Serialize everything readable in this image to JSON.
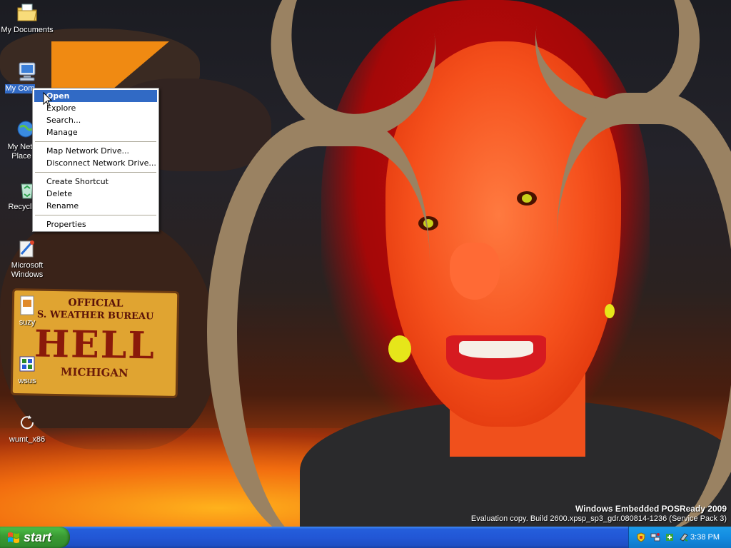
{
  "desktop": {
    "icons": [
      {
        "name": "my-documents",
        "label": "My Documents",
        "selected": false
      },
      {
        "name": "my-computer",
        "label": "My Computer",
        "selected": true
      },
      {
        "name": "my-network-places",
        "label": "My Network Places",
        "selected": false
      },
      {
        "name": "recycle-bin",
        "label": "Recycle Bin",
        "selected": false
      },
      {
        "name": "microsoft-windows",
        "label": "Microsoft Windows",
        "selected": false
      },
      {
        "name": "suzy",
        "label": "suzy",
        "selected": false
      },
      {
        "name": "wsus",
        "label": "wsus",
        "selected": false
      },
      {
        "name": "wumt-x86",
        "label": "wumt_x86",
        "selected": false
      }
    ],
    "visible_labels": {
      "my_documents": "My Documents",
      "my_computer": "My Com",
      "network_line1": "My Net",
      "network_line2": "Place",
      "recycle": "Recycl",
      "ms_windows_line1": "Microsoft",
      "ms_windows_line2": "Windows",
      "suzy": "suzy",
      "wsus": "wsus",
      "wumt": "wumt_x86"
    },
    "wallpaper_sign": {
      "line1": "OFFICIAL",
      "line2": "S. WEATHER BUREAU",
      "line3": "HELL",
      "line4": "MICHIGAN"
    }
  },
  "context_menu": {
    "items": [
      {
        "label": "Open",
        "default": true,
        "hover": true
      },
      {
        "label": "Explore"
      },
      {
        "label": "Search..."
      },
      {
        "label": "Manage"
      },
      {
        "label": "Map Network Drive..."
      },
      {
        "label": "Disconnect Network Drive..."
      },
      {
        "label": "Create Shortcut"
      },
      {
        "label": "Delete"
      },
      {
        "label": "Rename"
      },
      {
        "label": "Properties"
      }
    ]
  },
  "watermark": {
    "product": "Windows Embedded POSReady 2009",
    "build": "Evaluation copy. Build 2600.xpsp_sp3_gdr.080814-1236 (Service Pack 3)"
  },
  "taskbar": {
    "start_label": "start",
    "clock": "3:38 PM",
    "tray_icons": [
      "security-shield-icon",
      "network-icon",
      "update-icon",
      "safely-remove-icon"
    ]
  },
  "colors": {
    "taskbar_blue": "#245edb",
    "start_green": "#3a9a33",
    "selection_blue": "#316ac5",
    "tray_blue": "#138be0"
  }
}
